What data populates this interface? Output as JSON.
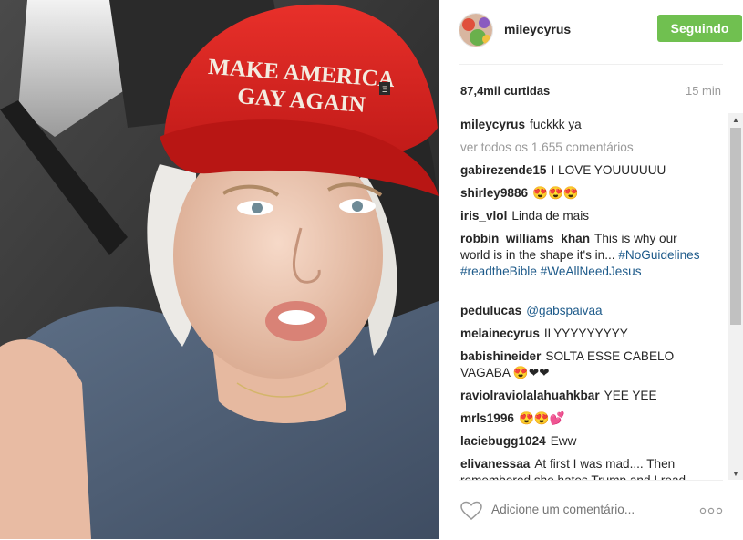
{
  "post": {
    "username": "mileycyrus",
    "follow_label": "Seguindo",
    "likes": "87,4mil curtidas",
    "time": "15 min",
    "view_all": "ver todos os 1.655 comentários",
    "add_comment_placeholder": "Adicione um comentário...",
    "cap_text_line1": "MAKE AMERICA",
    "cap_text_line2": "GAY AGAIN",
    "cap_badge": "Ξ"
  },
  "comments": [
    {
      "user": "mileycyrus",
      "text": "fuckkk ya"
    },
    {
      "user": "gabirezende15",
      "text": "I LOVE YOUUUUUU"
    },
    {
      "user": "shirley9886",
      "text": "😍😍😍"
    },
    {
      "user": "iris_vlol",
      "text": "Linda de mais"
    },
    {
      "user": "robbin_williams_khan",
      "text": "This is why our world is in the shape it's in...",
      "tags": "#NoGuidelines #readtheBible #WeAllNeedJesus"
    },
    {
      "user": "pedulucas",
      "text": "",
      "tags": "@gabspaivaa"
    },
    {
      "user": "melainecyrus",
      "text": "ILYYYYYYYYY"
    },
    {
      "user": "babishineider",
      "text": "SOLTA ESSE CABELO VAGABA 😍❤❤"
    },
    {
      "user": "raviolraviolalahuahkbar",
      "text": "YEE YEE"
    },
    {
      "user": "mrls1996",
      "text": "😍😍💕"
    },
    {
      "user": "laciebugg1024",
      "text": "Eww"
    },
    {
      "user": "elivanessaa",
      "text": "At first I was mad.... Then remembered she hates Trump and I read"
    }
  ],
  "colors": {
    "follow_green": "#70c050",
    "tag_blue": "#1d5a8a",
    "cap_red": "#e02020"
  },
  "icons": [
    "heart-icon",
    "more-options-icon",
    "scroll-up-arrow",
    "scroll-down-arrow"
  ]
}
